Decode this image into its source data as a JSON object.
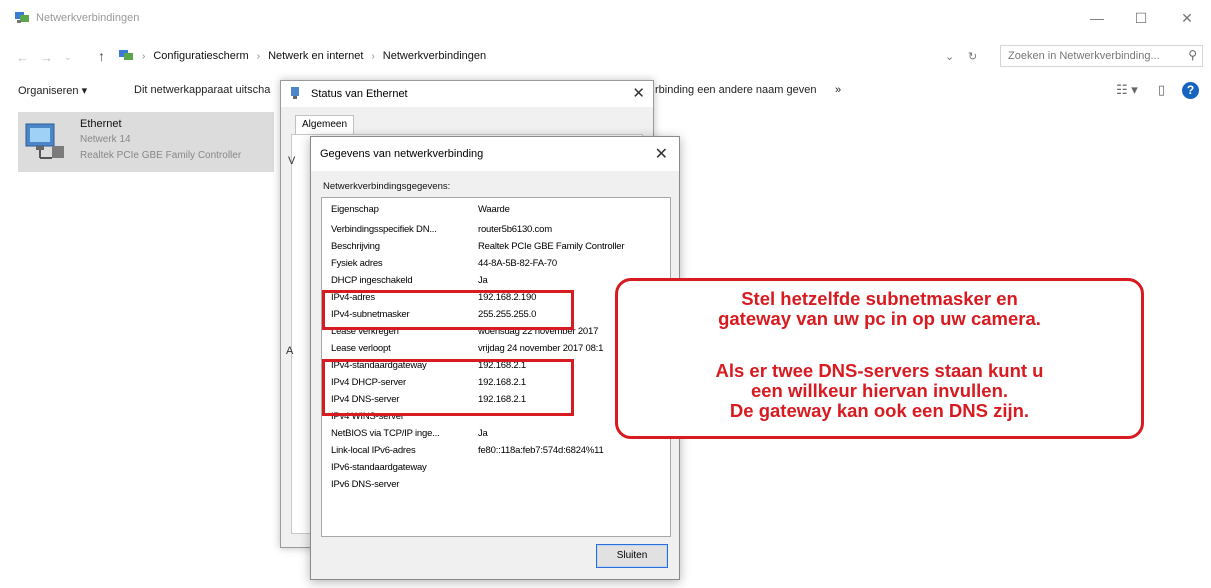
{
  "window": {
    "title": "Netwerkverbindingen",
    "minimize": "—",
    "maximize": "☐",
    "close": "✕"
  },
  "address": {
    "back": "←",
    "forward": "→",
    "up": "↑",
    "breadcrumbs": [
      "Configuratiescherm",
      "Netwerk en internet",
      "Netwerkverbindingen"
    ],
    "separator": "›",
    "dropdown": "⌄",
    "refresh": "↻",
    "search_placeholder": "Zoeken in Netwerkverbinding...",
    "search_icon": "⚲"
  },
  "toolbar": {
    "organize": "Organiseren ▾",
    "disable_device": "Dit netwerkapparaat uitscha",
    "rename": "rbinding een andere naam geven",
    "more": "»",
    "view": "☷ ▾",
    "pane": "▯",
    "help": "?"
  },
  "connection": {
    "name": "Ethernet",
    "network": "Netwerk 14",
    "adapter": "Realtek PCIe GBE Family Controller"
  },
  "status_dialog": {
    "title": "Status van Ethernet",
    "tab": "Algemeen",
    "close": "✕",
    "letter_v": "V",
    "letter_a": "A"
  },
  "details_dialog": {
    "title": "Gegevens van netwerkverbinding",
    "close": "✕",
    "section_label": "Netwerkverbindingsgegevens:",
    "header": {
      "property": "Eigenschap",
      "value": "Waarde"
    },
    "rows": [
      {
        "property": "Verbindingsspecifiek DN...",
        "value": "router5b6130.com"
      },
      {
        "property": "Beschrijving",
        "value": "Realtek PCIe GBE Family Controller"
      },
      {
        "property": "Fysiek adres",
        "value": "44-8A-5B-82-FA-70"
      },
      {
        "property": "DHCP ingeschakeld",
        "value": "Ja"
      },
      {
        "property": "IPv4-adres",
        "value": "192.168.2.190"
      },
      {
        "property": "IPv4-subnetmasker",
        "value": "255.255.255.0"
      },
      {
        "property": "Lease verkregen",
        "value": "woensdag 22 november 2017"
      },
      {
        "property": "Lease verloopt",
        "value": "vrijdag 24 november 2017 08:1"
      },
      {
        "property": "IPv4-standaardgateway",
        "value": "192.168.2.1"
      },
      {
        "property": "IPv4 DHCP-server",
        "value": "192.168.2.1"
      },
      {
        "property": "IPv4 DNS-server",
        "value": "192.168.2.1"
      },
      {
        "property": "IPv4 WINS-server",
        "value": ""
      },
      {
        "property": "NetBIOS via TCP/IP inge...",
        "value": "Ja"
      },
      {
        "property": "Link-local IPv6-adres",
        "value": "fe80::118a:feb7:574d:6824%11"
      },
      {
        "property": "IPv6-standaardgateway",
        "value": ""
      },
      {
        "property": "IPv6 DNS-server",
        "value": ""
      }
    ],
    "close_button": "Sluiten"
  },
  "callout": {
    "line1": "Stel hetzelfde subnetmasker en",
    "line2": "gateway van uw pc in op uw camera.",
    "line3": "Als er twee DNS-servers staan kunt u",
    "line4": "een willkeur hiervan  invullen.",
    "line5": "De gateway kan ook een DNS zijn."
  },
  "colors": {
    "highlight": "#d81b21",
    "help_blue": "#1565c0",
    "selected_item": "#dcdcdc"
  }
}
